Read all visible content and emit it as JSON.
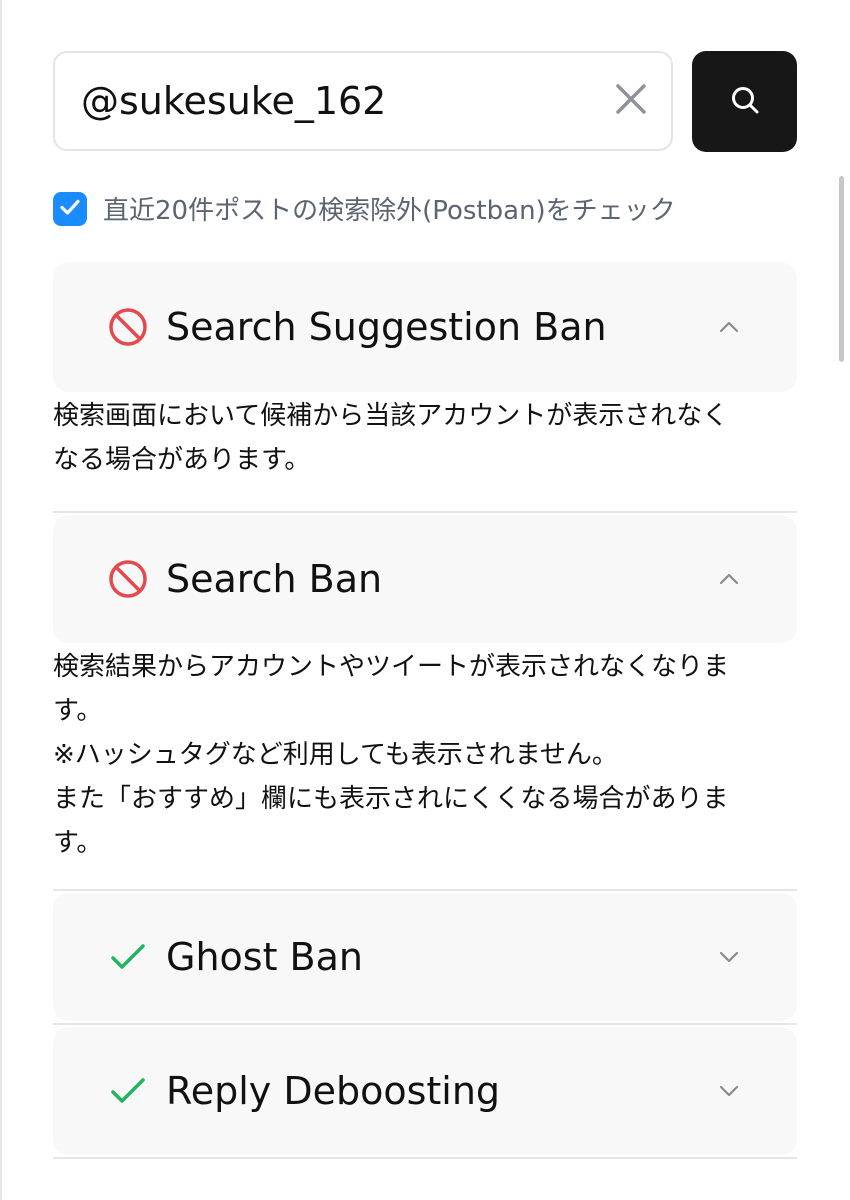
{
  "search": {
    "value": "@sukesuke_162",
    "search_icon": "search-icon",
    "clear_icon": "close-icon"
  },
  "options": {
    "postban_checked": true,
    "postban_label": "直近20件ポストの検索除外(Postban)をチェック"
  },
  "sections": [
    {
      "title": "Search Suggestion Ban",
      "status": "banned",
      "status_icon": "ban-icon",
      "expanded": true,
      "description": [
        "検索画面において候補から当該アカウントが表示されなく",
        "なる場合があります。"
      ]
    },
    {
      "title": "Search Ban",
      "status": "banned",
      "status_icon": "ban-icon",
      "expanded": true,
      "description": [
        "検索結果からアカウントやツイートが表示されなくなりま",
        "す。",
        "※ハッシュタグなど利用しても表示されません。",
        "また「おすすめ」欄にも表示されにくくなる場合がありま",
        "す。"
      ]
    },
    {
      "title": "Ghost Ban",
      "status": "ok",
      "status_icon": "check-icon",
      "expanded": false
    },
    {
      "title": "Reply Deboosting",
      "status": "ok",
      "status_icon": "check-icon",
      "expanded": false
    }
  ],
  "colors": {
    "ban": "#e5484d",
    "ok": "#22b35e",
    "accent": "#1a8cff",
    "button_dark": "#171717"
  }
}
